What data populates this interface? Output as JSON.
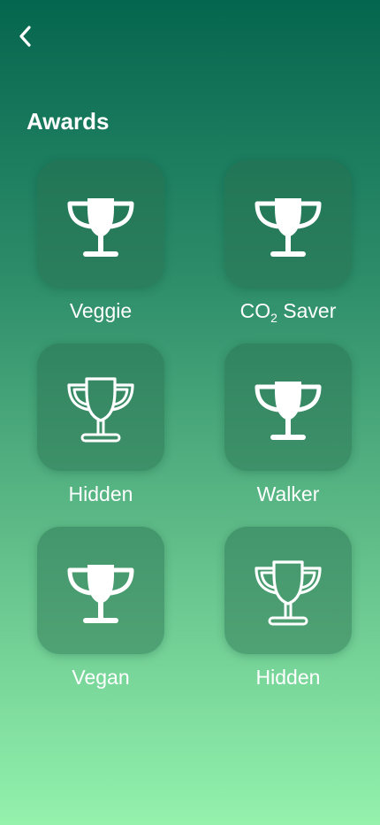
{
  "header": {
    "back_icon": "chevron-left-icon",
    "title": "Awards"
  },
  "awards": [
    {
      "label": "Veggie",
      "status": "earned",
      "icon": "trophy-filled-icon"
    },
    {
      "label_main": "CO",
      "label_sub": "2",
      "label_rest": " Saver",
      "status": "earned",
      "icon": "trophy-filled-icon"
    },
    {
      "label": "Hidden",
      "status": "locked",
      "icon": "trophy-outline-icon"
    },
    {
      "label": "Walker",
      "status": "earned",
      "icon": "trophy-filled-icon"
    },
    {
      "label": "Vegan",
      "status": "earned",
      "icon": "trophy-filled-icon"
    },
    {
      "label": "Hidden",
      "status": "locked",
      "icon": "trophy-outline-icon"
    }
  ],
  "colors": {
    "gradient_top": "#05664f",
    "gradient_bottom": "#94f2ad",
    "tile": "#2f7a5a",
    "icon": "#ffffff"
  }
}
